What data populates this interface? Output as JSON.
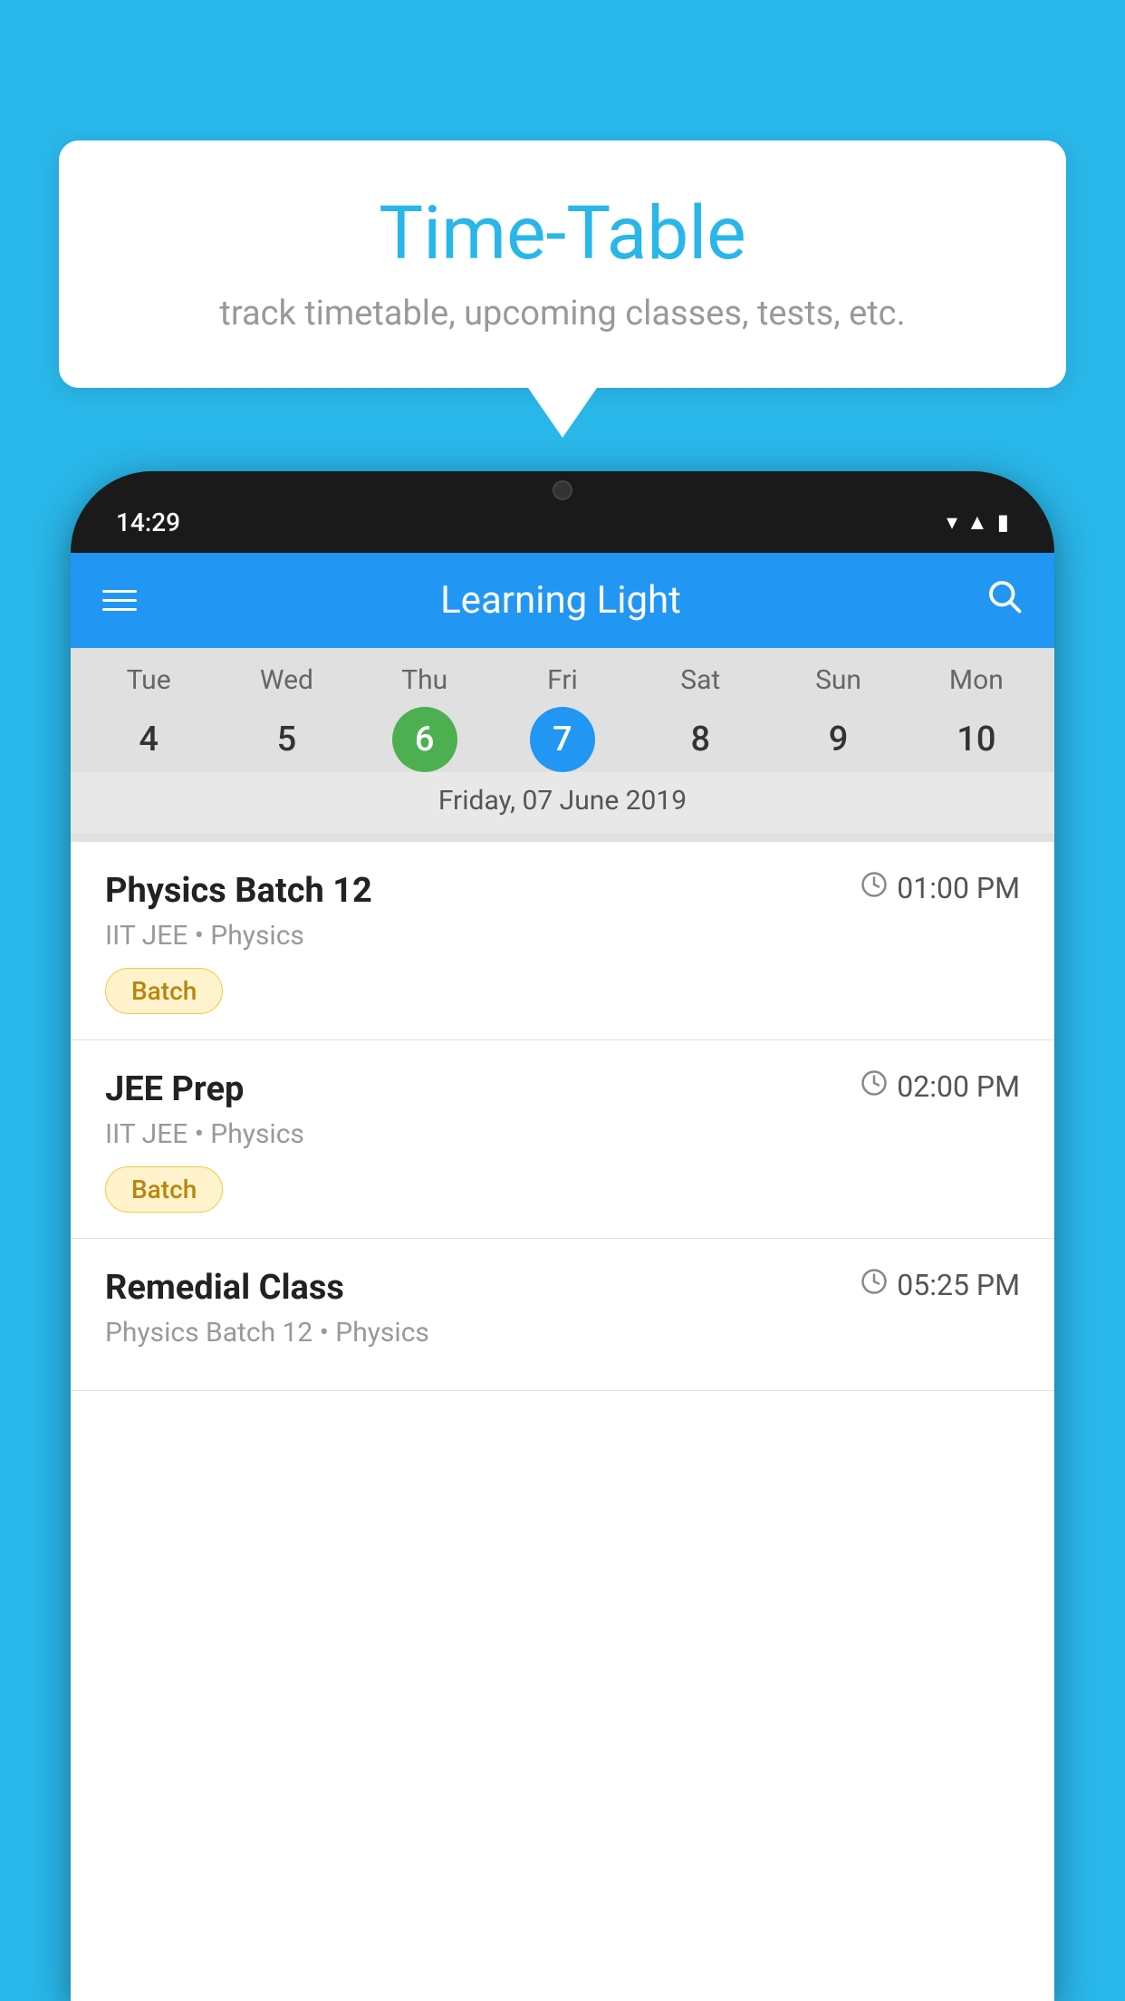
{
  "page": {
    "bg_color": "#29b6e8"
  },
  "speech_bubble": {
    "title": "Time-Table",
    "subtitle": "track timetable, upcoming classes, tests, etc."
  },
  "phone": {
    "status_bar": {
      "time": "14:29"
    },
    "toolbar": {
      "app_name": "Learning Light",
      "menu_icon": "☰",
      "search_icon": "🔍"
    },
    "calendar": {
      "days": [
        {
          "label": "Tue",
          "number": "4",
          "state": "normal"
        },
        {
          "label": "Wed",
          "number": "5",
          "state": "normal"
        },
        {
          "label": "Thu",
          "number": "6",
          "state": "today"
        },
        {
          "label": "Fri",
          "number": "7",
          "state": "selected"
        },
        {
          "label": "Sat",
          "number": "8",
          "state": "normal"
        },
        {
          "label": "Sun",
          "number": "9",
          "state": "normal"
        },
        {
          "label": "Mon",
          "number": "10",
          "state": "normal"
        }
      ],
      "selected_date_label": "Friday, 07 June 2019"
    },
    "schedule_items": [
      {
        "name": "Physics Batch 12",
        "time": "01:00 PM",
        "meta": "IIT JEE • Physics",
        "badge": "Batch"
      },
      {
        "name": "JEE Prep",
        "time": "02:00 PM",
        "meta": "IIT JEE • Physics",
        "badge": "Batch"
      },
      {
        "name": "Remedial Class",
        "time": "05:25 PM",
        "meta": "Physics Batch 12 • Physics",
        "badge": ""
      }
    ]
  }
}
